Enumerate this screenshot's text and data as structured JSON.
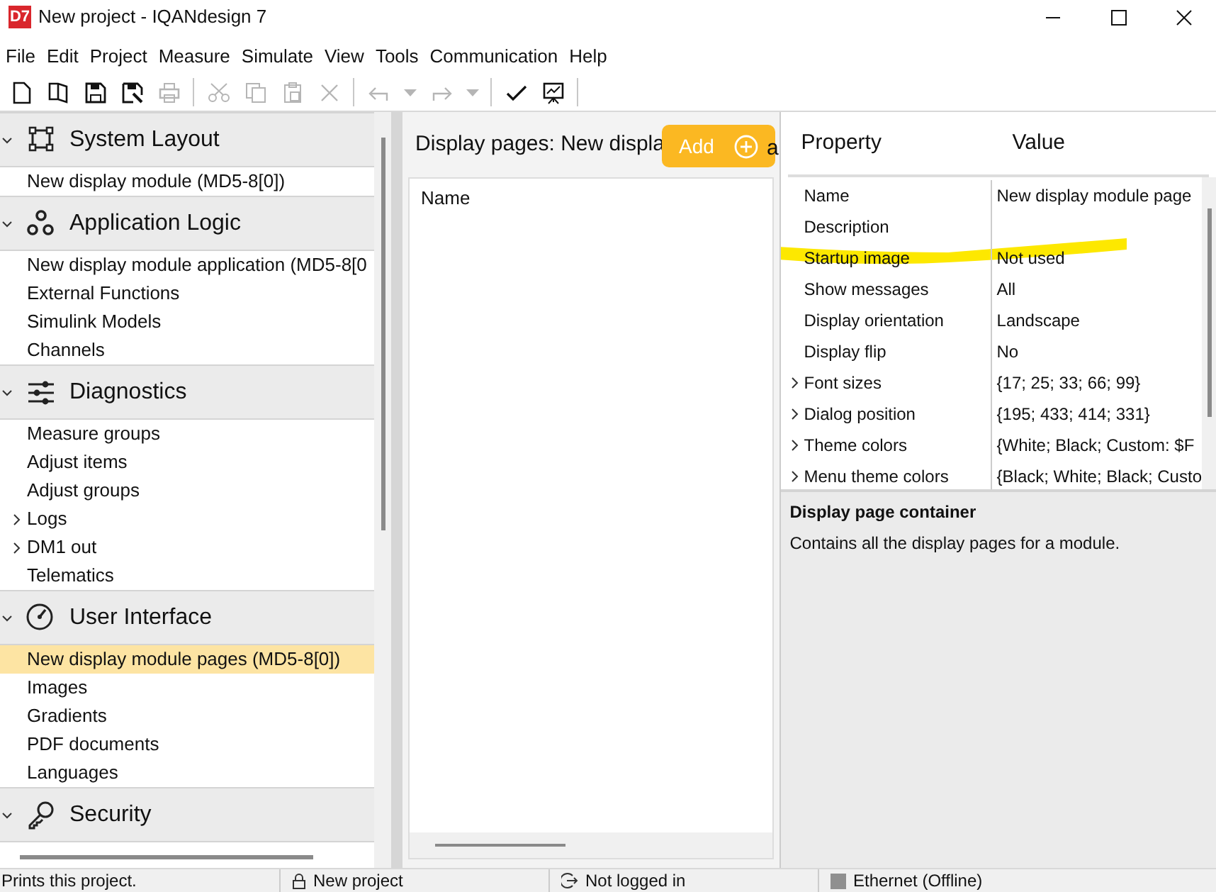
{
  "window": {
    "app_badge": "D7",
    "title": "New project - IQANdesign 7"
  },
  "menu": [
    "File",
    "Edit",
    "Project",
    "Measure",
    "Simulate",
    "View",
    "Tools",
    "Communication",
    "Help"
  ],
  "toolbar": [
    {
      "kind": "new",
      "disabled": false
    },
    {
      "kind": "open",
      "disabled": false
    },
    {
      "kind": "save",
      "disabled": false
    },
    {
      "kind": "saveas",
      "disabled": false
    },
    {
      "kind": "print",
      "disabled": true
    },
    {
      "kind": "separator"
    },
    {
      "kind": "cut",
      "disabled": true
    },
    {
      "kind": "copy",
      "disabled": true
    },
    {
      "kind": "paste",
      "disabled": true
    },
    {
      "kind": "delete",
      "disabled": true
    },
    {
      "kind": "separator"
    },
    {
      "kind": "undo",
      "disabled": true
    },
    {
      "kind": "dropdown",
      "disabled": true
    },
    {
      "kind": "redo",
      "disabled": true
    },
    {
      "kind": "dropdown",
      "disabled": true
    },
    {
      "kind": "separator"
    },
    {
      "kind": "check",
      "disabled": false
    },
    {
      "kind": "presentation",
      "disabled": false
    },
    {
      "kind": "separator"
    }
  ],
  "sidebar": {
    "sections": [
      {
        "title": "System Layout",
        "expanded": true,
        "items": [
          {
            "label": "New display module (MD5-8[0])",
            "selected": false,
            "expandable": false
          }
        ]
      },
      {
        "title": "Application Logic",
        "expanded": true,
        "items": [
          {
            "label": "New display module application (MD5-8[0",
            "selected": false,
            "expandable": false
          },
          {
            "label": "External Functions",
            "selected": false,
            "expandable": false
          },
          {
            "label": "Simulink Models",
            "selected": false,
            "expandable": false
          },
          {
            "label": "Channels",
            "selected": false,
            "expandable": false
          }
        ]
      },
      {
        "title": "Diagnostics",
        "expanded": true,
        "items": [
          {
            "label": "Measure groups",
            "selected": false,
            "expandable": false
          },
          {
            "label": "Adjust items",
            "selected": false,
            "expandable": false
          },
          {
            "label": "Adjust groups",
            "selected": false,
            "expandable": false
          },
          {
            "label": "Logs",
            "selected": false,
            "expandable": true
          },
          {
            "label": "DM1 out",
            "selected": false,
            "expandable": true
          },
          {
            "label": "Telematics",
            "selected": false,
            "expandable": false
          }
        ]
      },
      {
        "title": "User Interface",
        "expanded": true,
        "items": [
          {
            "label": "New display module pages (MD5-8[0])",
            "selected": true,
            "expandable": false
          },
          {
            "label": "Images",
            "selected": false,
            "expandable": false
          },
          {
            "label": "Gradients",
            "selected": false,
            "expandable": false
          },
          {
            "label": "PDF documents",
            "selected": false,
            "expandable": false
          },
          {
            "label": "Languages",
            "selected": false,
            "expandable": false
          }
        ]
      },
      {
        "title": "Security",
        "expanded": true
      }
    ]
  },
  "pages_panel": {
    "heading": "Display pages: New displa",
    "heading_tail": "a",
    "add_button": "Add",
    "columns": [
      "Name"
    ]
  },
  "properties": {
    "columns": [
      "Property",
      "Value"
    ],
    "rows": [
      {
        "name": "Name",
        "value": "New display module page",
        "expandable": false,
        "highlighted": false
      },
      {
        "name": "Description",
        "expandable": false,
        "highlighted": false
      },
      {
        "name": "Startup image",
        "value": "Not used",
        "expandable": false,
        "highlighted": true
      },
      {
        "name": "Show messages",
        "value": "All",
        "expandable": false,
        "highlighted": false
      },
      {
        "name": "Display orientation",
        "value": "Landscape",
        "expandable": false,
        "highlighted": false
      },
      {
        "name": "Display flip",
        "value": "No",
        "expandable": false,
        "highlighted": false
      },
      {
        "name": "Font sizes",
        "value": "{17; 25; 33; 66; 99}",
        "expandable": true,
        "highlighted": false
      },
      {
        "name": "Dialog position",
        "value": "{195; 433; 414; 331}",
        "expandable": true,
        "highlighted": false
      },
      {
        "name": "Theme colors",
        "value": "{White; Black; Custom: $F",
        "expandable": true,
        "highlighted": false
      },
      {
        "name": "Menu theme colors",
        "value": "{Black; White; Black; Custo",
        "expandable": true,
        "highlighted": false
      }
    ],
    "description_title": "Display page container",
    "description_text": "Contains all the display pages for a module."
  },
  "status_bar": [
    {
      "kind": "text",
      "text": "Prints this project."
    },
    {
      "kind": "lock",
      "text": "New project"
    },
    {
      "kind": "login",
      "text": "Not logged in"
    },
    {
      "kind": "connection",
      "text": "Ethernet (Offline)"
    }
  ]
}
